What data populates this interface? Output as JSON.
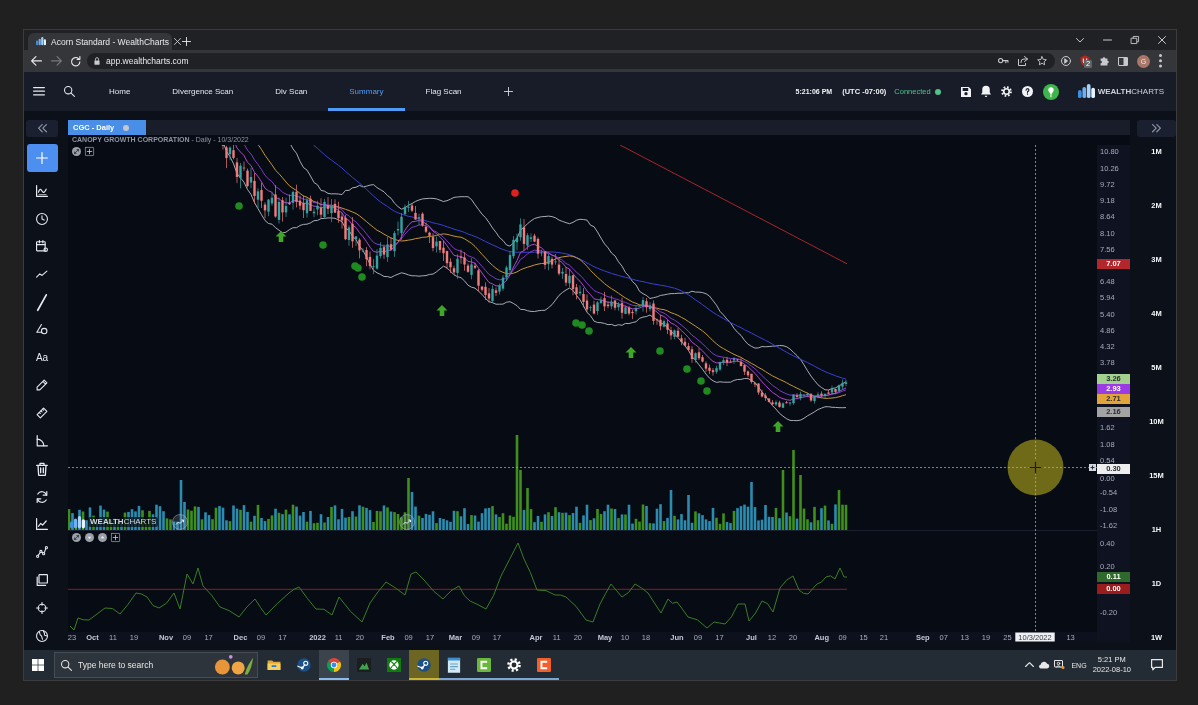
{
  "browser": {
    "tab": {
      "title": "Acorn Standard - WealthCharts"
    },
    "url": "app.wealthcharts.com",
    "forward": {
      "disabled": true
    },
    "extension_badge": "2",
    "profile_initial": "G"
  },
  "app_nav": {
    "tabs": [
      {
        "label": "Home",
        "selected": false
      },
      {
        "label": "Divergence Scan",
        "selected": false
      },
      {
        "label": "Div Scan",
        "selected": false
      },
      {
        "label": "Summary",
        "selected": true
      },
      {
        "label": "Flag Scan",
        "selected": false
      }
    ],
    "clock": "5:21:06 PM",
    "timezone": "(UTC -07:00)",
    "connection": {
      "label": "Connected",
      "connected": true
    },
    "logo": "**WEALTH**CHARTS"
  },
  "drawing_toolbar": {
    "text_tool": "Aa"
  },
  "chart": {
    "tab": "CGC - Daily",
    "title": "**CANOPY GROWTH CORPORATION** - Daily - 10/3/2022",
    "logo": "**WEALTH**CHARTS",
    "price_axis": {
      "labels": [
        "10.80",
        "10.26",
        "9.72",
        "9.18",
        "8.64",
        "8.10",
        "7.56",
        "6.48",
        "5.94",
        "5.40",
        "4.86",
        "4.32",
        "3.78",
        "1.62",
        "1.08",
        "0.54",
        "0.00",
        "-0.54",
        "-1.08",
        "-1.62"
      ],
      "badges": [
        {
          "value": "7.07",
          "color": "#b3262b"
        },
        {
          "value": "3.26",
          "color": "#a3d18e"
        },
        {
          "value": "2.93",
          "color": "#9b3be6"
        },
        {
          "value": "2.71",
          "color": "#e2a43a"
        },
        {
          "value": "2.16",
          "color": "#a3a3a3"
        },
        {
          "value": "0.30",
          "color": "#eeeeee"
        }
      ]
    },
    "oscillator_axis": {
      "labels": [
        "0.40",
        "0.20",
        "-0.20"
      ],
      "badges": [
        {
          "value": "0.11",
          "color": "#2f6a2c"
        },
        {
          "value": "0.00",
          "color": "#9a1c1c"
        }
      ]
    },
    "time_axis": [
      {
        "label": "23",
        "kind": "minor"
      },
      {
        "label": "Oct",
        "kind": "major"
      },
      {
        "label": "11",
        "kind": "minor"
      },
      {
        "label": "19",
        "kind": "minor"
      },
      {
        "label": "Nov",
        "kind": "major"
      },
      {
        "label": "09",
        "kind": "minor"
      },
      {
        "label": "17",
        "kind": "minor"
      },
      {
        "label": "Dec",
        "kind": "major"
      },
      {
        "label": "09",
        "kind": "minor"
      },
      {
        "label": "17",
        "kind": "minor"
      },
      {
        "label": "2022",
        "kind": "major"
      },
      {
        "label": "11",
        "kind": "minor"
      },
      {
        "label": "20",
        "kind": "minor"
      },
      {
        "label": "Feb",
        "kind": "major"
      },
      {
        "label": "09",
        "kind": "minor"
      },
      {
        "label": "17",
        "kind": "minor"
      },
      {
        "label": "Mar",
        "kind": "major"
      },
      {
        "label": "09",
        "kind": "minor"
      },
      {
        "label": "17",
        "kind": "minor"
      },
      {
        "label": "Apr",
        "kind": "major"
      },
      {
        "label": "11",
        "kind": "minor"
      },
      {
        "label": "20",
        "kind": "minor"
      },
      {
        "label": "May",
        "kind": "major"
      },
      {
        "label": "10",
        "kind": "minor"
      },
      {
        "label": "18",
        "kind": "minor"
      },
      {
        "label": "Jun",
        "kind": "major"
      },
      {
        "label": "09",
        "kind": "minor"
      },
      {
        "label": "17",
        "kind": "minor"
      },
      {
        "label": "Jul",
        "kind": "major"
      },
      {
        "label": "12",
        "kind": "minor"
      },
      {
        "label": "20",
        "kind": "minor"
      },
      {
        "label": "Aug",
        "kind": "major"
      },
      {
        "label": "09",
        "kind": "minor"
      },
      {
        "label": "15",
        "kind": "minor"
      },
      {
        "label": "21",
        "kind": "minor"
      },
      {
        "label": "Sep",
        "kind": "major"
      },
      {
        "label": "07",
        "kind": "minor"
      },
      {
        "label": "13",
        "kind": "minor"
      },
      {
        "label": "19",
        "kind": "minor"
      },
      {
        "label": "25",
        "kind": "minor"
      },
      {
        "label": "10/3/2022",
        "kind": "cursor"
      },
      {
        "label": "13",
        "kind": "minor"
      }
    ]
  },
  "timeframes": [
    "1M",
    "2M",
    "3M",
    "4M",
    "5M",
    "10M",
    "15M",
    "1H",
    "1D",
    "1W"
  ],
  "taskbar": {
    "search_placeholder": "Type here to search",
    "apps": [
      {
        "running": false,
        "selected": false,
        "attention": false
      },
      {
        "running": false,
        "selected": false,
        "attention": false
      },
      {
        "running": true,
        "selected": true,
        "attention": false
      },
      {
        "running": false,
        "selected": false,
        "attention": false
      },
      {
        "running": false,
        "selected": false,
        "attention": false
      },
      {
        "running": true,
        "selected": false,
        "attention": true
      },
      {
        "running": true,
        "selected": false,
        "attention": false
      },
      {
        "running": true,
        "selected": false,
        "attention": false
      },
      {
        "running": true,
        "selected": false,
        "attention": false
      },
      {
        "running": true,
        "selected": false,
        "attention": false
      }
    ],
    "language": "ENG",
    "time": "5:21 PM",
    "date": "2022-08-10"
  }
}
